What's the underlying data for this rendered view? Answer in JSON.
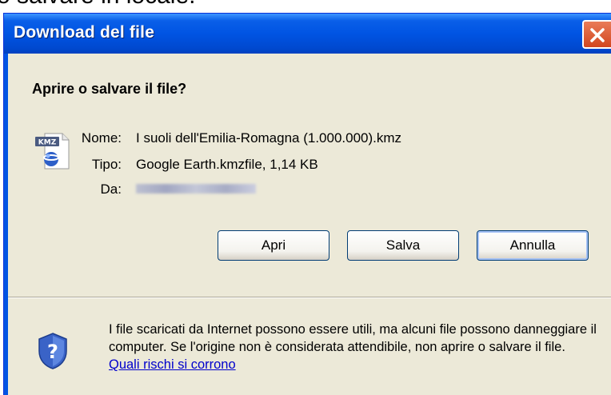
{
  "page": {
    "background_text": "o salvare in locale."
  },
  "dialog": {
    "title": "Download del file",
    "question": "Aprire o salvare il file?",
    "file_icon": {
      "name": "kmz-file-icon",
      "label": "KMZ"
    },
    "fields": {
      "name_label": "Nome:",
      "name_value": "I suoli dell'Emilia-Romagna (1.000.000).kmz",
      "type_label": "Tipo:",
      "type_value": "Google Earth.kmzfile, 1,14 KB",
      "from_label": "Da:",
      "from_value": ""
    },
    "buttons": {
      "open": "Apri",
      "save": "Salva",
      "cancel": "Annulla"
    },
    "warning": {
      "text": "I file scaricati da Internet possono essere utili, ma alcuni file possono danneggiare il computer. Se l'origine non è considerata attendibile, non aprire o salvare il file.",
      "link": "Quali rischi si corrono"
    }
  },
  "colors": {
    "titlebar": "#0054E3",
    "dialog_bg": "#ECE9D8",
    "close_button": "#D2461F",
    "link": "#0000CC"
  }
}
